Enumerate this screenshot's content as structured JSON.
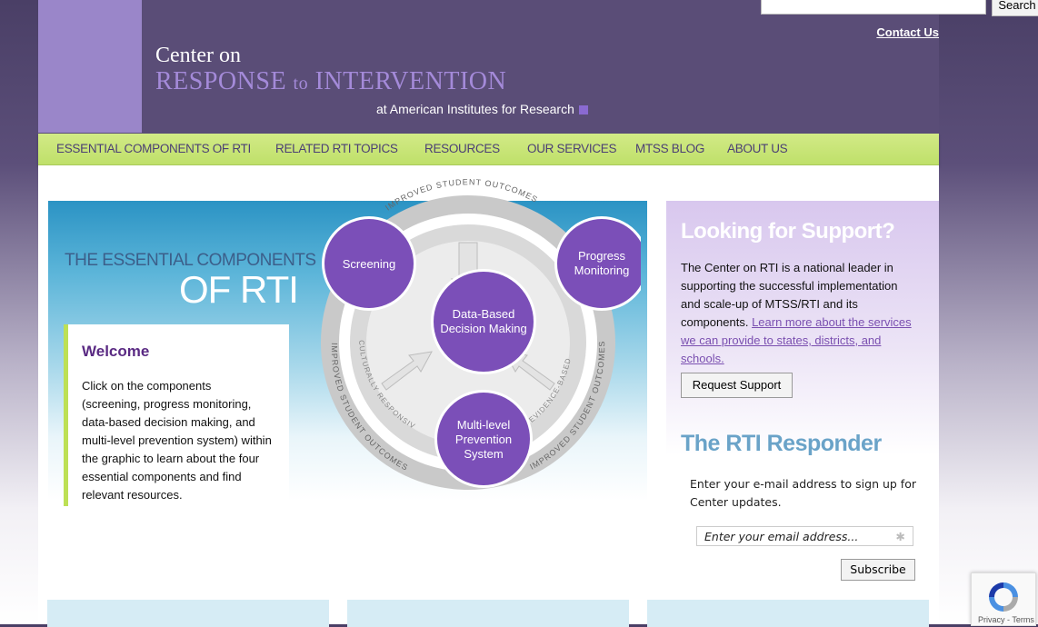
{
  "header": {
    "logo_line1": "Center on",
    "logo_line2_a": "RESPONSE",
    "logo_line2_to": "to",
    "logo_line2_b": "INTERVENTION",
    "logo_line3": "at American Institutes for Research",
    "search_button": "Search",
    "contact_link": "Contact Us"
  },
  "nav": [
    {
      "label": "ESSENTIAL COMPONENTS OF RTI"
    },
    {
      "label": "RELATED RTI TOPICS"
    },
    {
      "label": "RESOURCES"
    },
    {
      "label": "OUR SERVICES"
    },
    {
      "label": "MTSS BLOG"
    },
    {
      "label": "ABOUT US"
    }
  ],
  "hero": {
    "title_line1": "THE ESSENTIAL COMPONENTS",
    "title_line2": "OF RTI",
    "welcome_title": "Welcome",
    "welcome_body": "Click on the components (screening, progress monitoring, data-based decision making, and multi-level prevention system) within the graphic to learn about the four essential components and find relevant resources."
  },
  "diagram": {
    "screening": "Screening",
    "progress_1": "Progress",
    "progress_2": "Monitoring",
    "center_1": "Data-Based",
    "center_2": "Decision Making",
    "multi_1": "Multi-level",
    "multi_2": "Prevention",
    "multi_3": "System",
    "ring_top": "IMPROVED STUDENT OUTCOMES",
    "ring_left": "IMPROVED STUDENT OUTCOMES",
    "ring_right": "IMPROVED STUDENT OUTCOMES",
    "inner_left": "CULTURALLY RESPONSIVE",
    "inner_right": "EVIDENCE-BASED"
  },
  "sidebar": {
    "support_title": "Looking for Support?",
    "support_text": "The Center on RTI is a national leader in supporting the successful implementation and scale-up of MTSS/RTI and its components.",
    "support_link": "Learn more about the services we can provide to states, districts, and schools.",
    "request_button": "Request Support",
    "responder_title": "The RTI Responder",
    "responder_text": "Enter your e-mail address to sign up for Center updates.",
    "email_placeholder": "Enter your email address...",
    "subscribe_button": "Subscribe"
  },
  "recaptcha": {
    "links": "Privacy - Terms"
  },
  "colors": {
    "header": "#5a4d77",
    "nav": "#c9e57a",
    "purple": "#7b4fb8",
    "link": "#7a4fb0"
  }
}
